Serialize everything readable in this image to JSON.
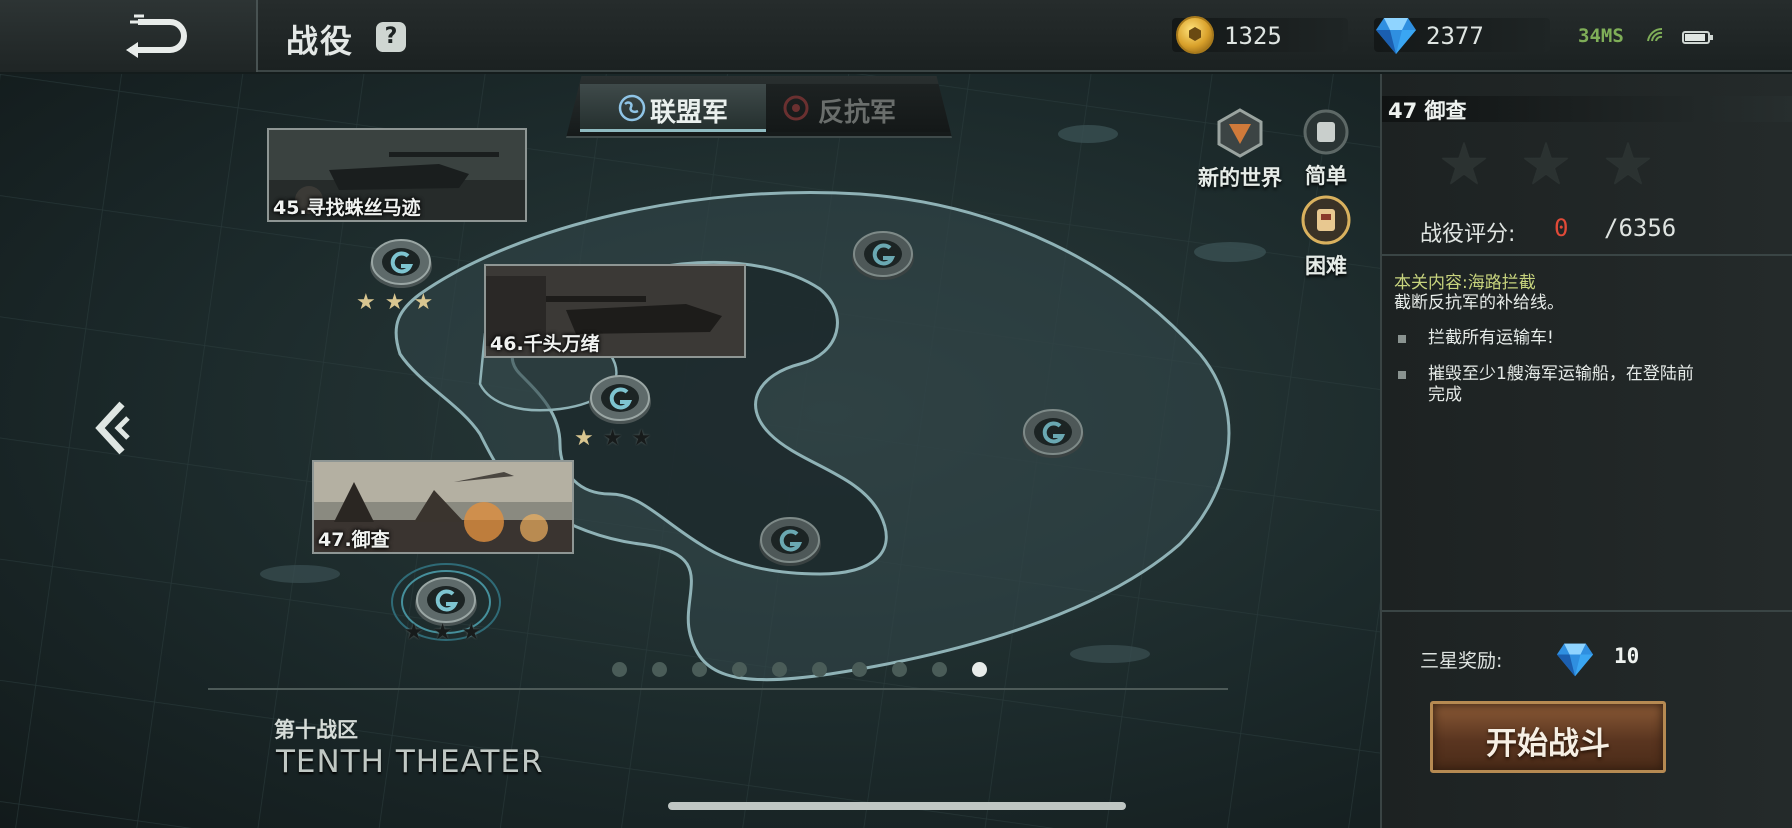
{
  "header": {
    "title": "战役",
    "help_icon": "?",
    "gold": "1325",
    "gems": "2377",
    "ping": "34MS"
  },
  "faction_tabs": [
    {
      "label": "联盟军",
      "active": true
    },
    {
      "label": "反抗军",
      "active": false
    }
  ],
  "modes": {
    "new_world": "新的世界",
    "easy": "简单",
    "hard": "困难"
  },
  "stages": [
    {
      "name": "45.寻找蛛丝马迹",
      "stars": 3
    },
    {
      "name": "46.千头万绪",
      "stars": 1
    },
    {
      "name": "47.御查",
      "stars": 0
    }
  ],
  "theater": {
    "cn": "第十战区",
    "en": "TENTH THEATER",
    "page_count": 10,
    "current_page": 10
  },
  "panel": {
    "stage_title": "47 御查",
    "rating_stars": 0,
    "score_label": "战役评分:",
    "score": "0",
    "score_max": "/6356",
    "objective_title": "本关内容:海路拦截",
    "objective_desc": "截断反抗军的补给线。",
    "objectives": [
      "拦截所有运输车!",
      "摧毁至少1艘海军运输船，在登陆前完成"
    ],
    "reward_label": "三星奖励:",
    "reward_value": "10",
    "start_button": "开始战斗"
  },
  "colors": {
    "score_value": "#e04a38",
    "objective_title": "#c7d37d",
    "start_button": "#5a3520",
    "ping": "#7fae58"
  }
}
